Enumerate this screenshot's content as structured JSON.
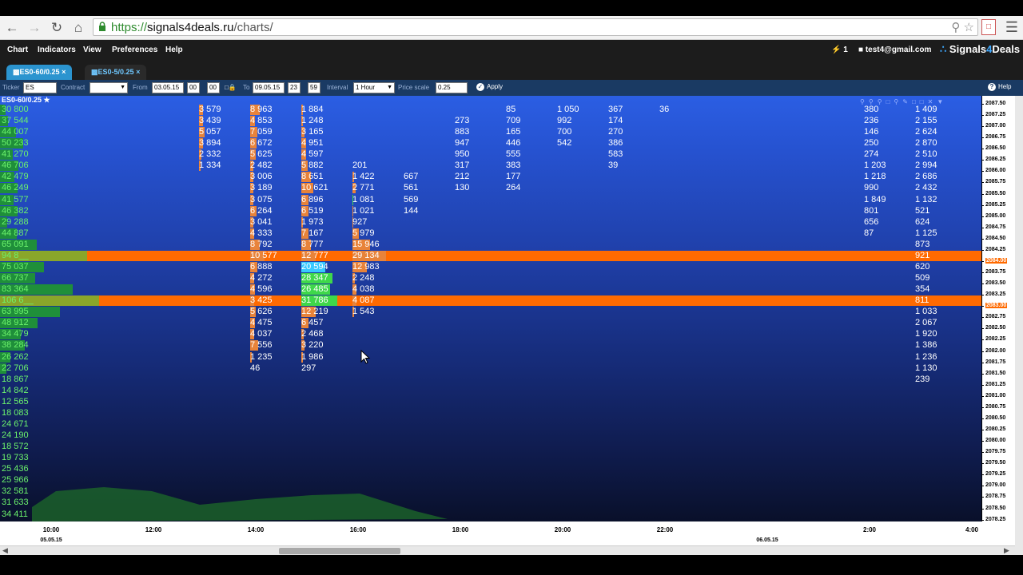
{
  "browser": {
    "url_scheme": "https://",
    "url_host": "signals4deals.ru",
    "url_path": "/charts/"
  },
  "appbar": {
    "menu": [
      "Chart",
      "Indicators",
      "View",
      "Preferences",
      "Help"
    ],
    "alerts_count": "1",
    "user_email": "test4@gmail.com",
    "logo_prefix": "Signals",
    "logo_four": "4",
    "logo_suffix": "Deals"
  },
  "tabs": [
    {
      "label": "ES0-60/0.25",
      "active": true
    },
    {
      "label": "ES0-5/0.25",
      "active": false
    }
  ],
  "params": {
    "ticker_label": "Ticker",
    "ticker_value": "ES",
    "contract_label": "Contract",
    "contract_value": "",
    "from_label": "From",
    "from_date": "03.05.15",
    "from_hour": "00",
    "from_min": "00",
    "to_label": "To",
    "to_date": "09.05.15",
    "to_hour": "23",
    "to_min": "59",
    "interval_label": "Interval",
    "interval_value": "1 Hour",
    "price_scale_label": "Price scale",
    "price_scale_value": "0.25",
    "apply_label": "Apply",
    "help_label": "Help"
  },
  "chart": {
    "title": "ES0-60/0.25 ★",
    "volume_profile": [
      "30 800",
      "37 544",
      "44 007",
      "50 233",
      "41 270",
      "46 706",
      "42 479",
      "46 249",
      "41 577",
      "46 382",
      "29 288",
      "44 887",
      "65 091",
      "94 8__",
      "75 037",
      "66 737",
      "83 364",
      "106 6__",
      "63 995",
      "48 912",
      "34 479",
      "38 284",
      "26 262",
      "22 706",
      "18 867",
      "14 842",
      "12 565",
      "18 083",
      "24 671",
      "24 190",
      "18 572",
      "19 733",
      "25 436",
      "25 966",
      "32 581",
      "31 633",
      "34 411"
    ],
    "profile_fractions": [
      0.05,
      0.08,
      0.15,
      0.22,
      0.12,
      0.18,
      0.14,
      0.17,
      0.13,
      0.17,
      0.07,
      0.16,
      0.35,
      0.84,
      0.42,
      0.34,
      0.7,
      0.95,
      0.58,
      0.36,
      0.2,
      0.24,
      0.1,
      0.06,
      0,
      0,
      0,
      0,
      0,
      0,
      0,
      0,
      0,
      0,
      0,
      0,
      0
    ],
    "highlight_rows": [
      13,
      17
    ],
    "columns": [
      {
        "time_index": 3,
        "start_row": 1,
        "cells": [
          "3 579",
          "3 439",
          "5 057",
          "3 894",
          "2 332",
          "1 334"
        ]
      },
      {
        "time_index": 4,
        "start_row": 1,
        "cells": [
          "8 963",
          "4 853",
          "7 059",
          "6 672",
          "5 625",
          "2 482",
          "3 006",
          "3 189",
          "3 075",
          "6 264",
          "3 041",
          "4 333",
          "8 792",
          "10 577",
          "6 888",
          "4 272",
          "4 596",
          "3 425",
          "5 626",
          "4 475",
          "4 037",
          "7 556",
          "1 235",
          "46"
        ]
      },
      {
        "time_index": 5,
        "start_row": 1,
        "cells": [
          "1 884",
          "1 248",
          "3 165",
          "4 951",
          "4 597",
          "5 882",
          "8 651",
          "10 621",
          "6 896",
          "6 519",
          "1 973",
          "7 167",
          "8 777",
          "12 777",
          "20 594",
          "28 347",
          "26 485",
          "31 786",
          "12 219",
          "6 457",
          "2 468",
          "3 220",
          "1 986",
          "297"
        ]
      },
      {
        "time_index": 6,
        "start_row": 6,
        "cells": [
          "201",
          "1 422",
          "2 771",
          "1 081",
          "1 021",
          "927",
          "5 979",
          "15 946",
          "29 134",
          "12 983",
          "2 248",
          "4 038",
          "4 087",
          "1 543"
        ]
      },
      {
        "time_index": 7,
        "start_row": 7,
        "cells": [
          "667",
          "561",
          "569",
          "144"
        ]
      },
      {
        "time_index": 8,
        "start_row": 2,
        "cells": [
          "273",
          "883",
          "947",
          "950",
          "317",
          "212",
          "130"
        ]
      },
      {
        "time_index": 9,
        "start_row": 1,
        "cells": [
          "85",
          "709",
          "165",
          "446",
          "555",
          "383",
          "177",
          "264"
        ]
      },
      {
        "time_index": 10,
        "start_row": 1,
        "cells": [
          "1 050",
          "992",
          "700",
          "542"
        ]
      },
      {
        "time_index": 11,
        "start_row": 1,
        "cells": [
          "367",
          "174",
          "270",
          "386",
          "583",
          "39"
        ]
      },
      {
        "time_index": 12,
        "start_row": 1,
        "cells": [
          "36"
        ]
      },
      {
        "time_index": 16,
        "start_row": 1,
        "cells": [
          "380",
          "236",
          "146",
          "250",
          "274",
          "1 203",
          "1 218",
          "990",
          "1 849",
          "801",
          "656",
          "87"
        ]
      },
      {
        "time_index": 17,
        "start_row": 1,
        "cells": [
          "1 409",
          "2 155",
          "2 624",
          "2 870",
          "2 510",
          "2 994",
          "2 686",
          "2 432",
          "1 132",
          "521",
          "624",
          "1 125",
          "873",
          "921",
          "620",
          "509",
          "354",
          "811",
          "1 033",
          "2 067",
          "1 920",
          "1 386",
          "1 236",
          "1 130",
          "239"
        ]
      }
    ],
    "bar_fractions": {
      "4": [
        0.2,
        0.1,
        0.15,
        0.13,
        0.12,
        0.06,
        0.07,
        0.07,
        0.07,
        0.13,
        0.07,
        0.09,
        0.2,
        0.3,
        0.15,
        0.09,
        0.1,
        0.08,
        0.12,
        0.1,
        0.09,
        0.16,
        0.03,
        0
      ],
      "5": [
        0.04,
        0.03,
        0.07,
        0.1,
        0.1,
        0.13,
        0.2,
        0.25,
        0.15,
        0.15,
        0.04,
        0.15,
        0.2,
        0.3,
        0.5,
        0.65,
        0.6,
        0.75,
        0.3,
        0.15,
        0.05,
        0.07,
        0.04,
        0
      ],
      "6": [
        0,
        0.03,
        0.06,
        0.02,
        0.02,
        0.02,
        0.13,
        0.37,
        0.7,
        0.3,
        0.05,
        0.09,
        0.09,
        0.03
      ],
      "3": [
        0.08,
        0.08,
        0.12,
        0.09,
        0.05,
        0.03
      ]
    },
    "bar_colors": {
      "5": {
        "14": "cyan",
        "15": "green",
        "16": "green",
        "17": "green"
      },
      "6": {
        "8": "green"
      }
    },
    "y_ticks": [
      "2087.50",
      "2087.25",
      "2087.00",
      "2086.75",
      "2086.50",
      "2086.25",
      "2086.00",
      "2085.75",
      "2085.50",
      "2085.25",
      "2085.00",
      "2084.75",
      "2084.50",
      "2084.25",
      "2084.00",
      "2083.75",
      "2083.50",
      "2083.25",
      "2083.00",
      "2082.75",
      "2082.50",
      "2082.25",
      "2082.00",
      "2081.75",
      "2081.50",
      "2081.25",
      "2081.00",
      "2080.75",
      "2080.50",
      "2080.25",
      "2080.00",
      "2079.75",
      "2079.50",
      "2079.25",
      "2079.00",
      "2078.75",
      "2078.50",
      "2078.25"
    ],
    "y_highlight": [
      "2084.00",
      "2083.00"
    ],
    "x_ticks": [
      {
        "label": "10:00",
        "time_index": 0
      },
      {
        "label": "12:00",
        "time_index": 2
      },
      {
        "label": "14:00",
        "time_index": 4
      },
      {
        "label": "16:00",
        "time_index": 6
      },
      {
        "label": "18:00",
        "time_index": 8
      },
      {
        "label": "20:00",
        "time_index": 10
      },
      {
        "label": "22:00",
        "time_index": 12
      },
      {
        "label": "2:00",
        "time_index": 16
      },
      {
        "label": "4:00",
        "time_index": 18
      }
    ],
    "x_dates": [
      {
        "label": "05.05.15",
        "time_index": 0
      },
      {
        "label": "06.05.15",
        "time_index": 14
      }
    ],
    "accent_orange": "#ff6a00",
    "volume_green": "#6cf36c"
  }
}
